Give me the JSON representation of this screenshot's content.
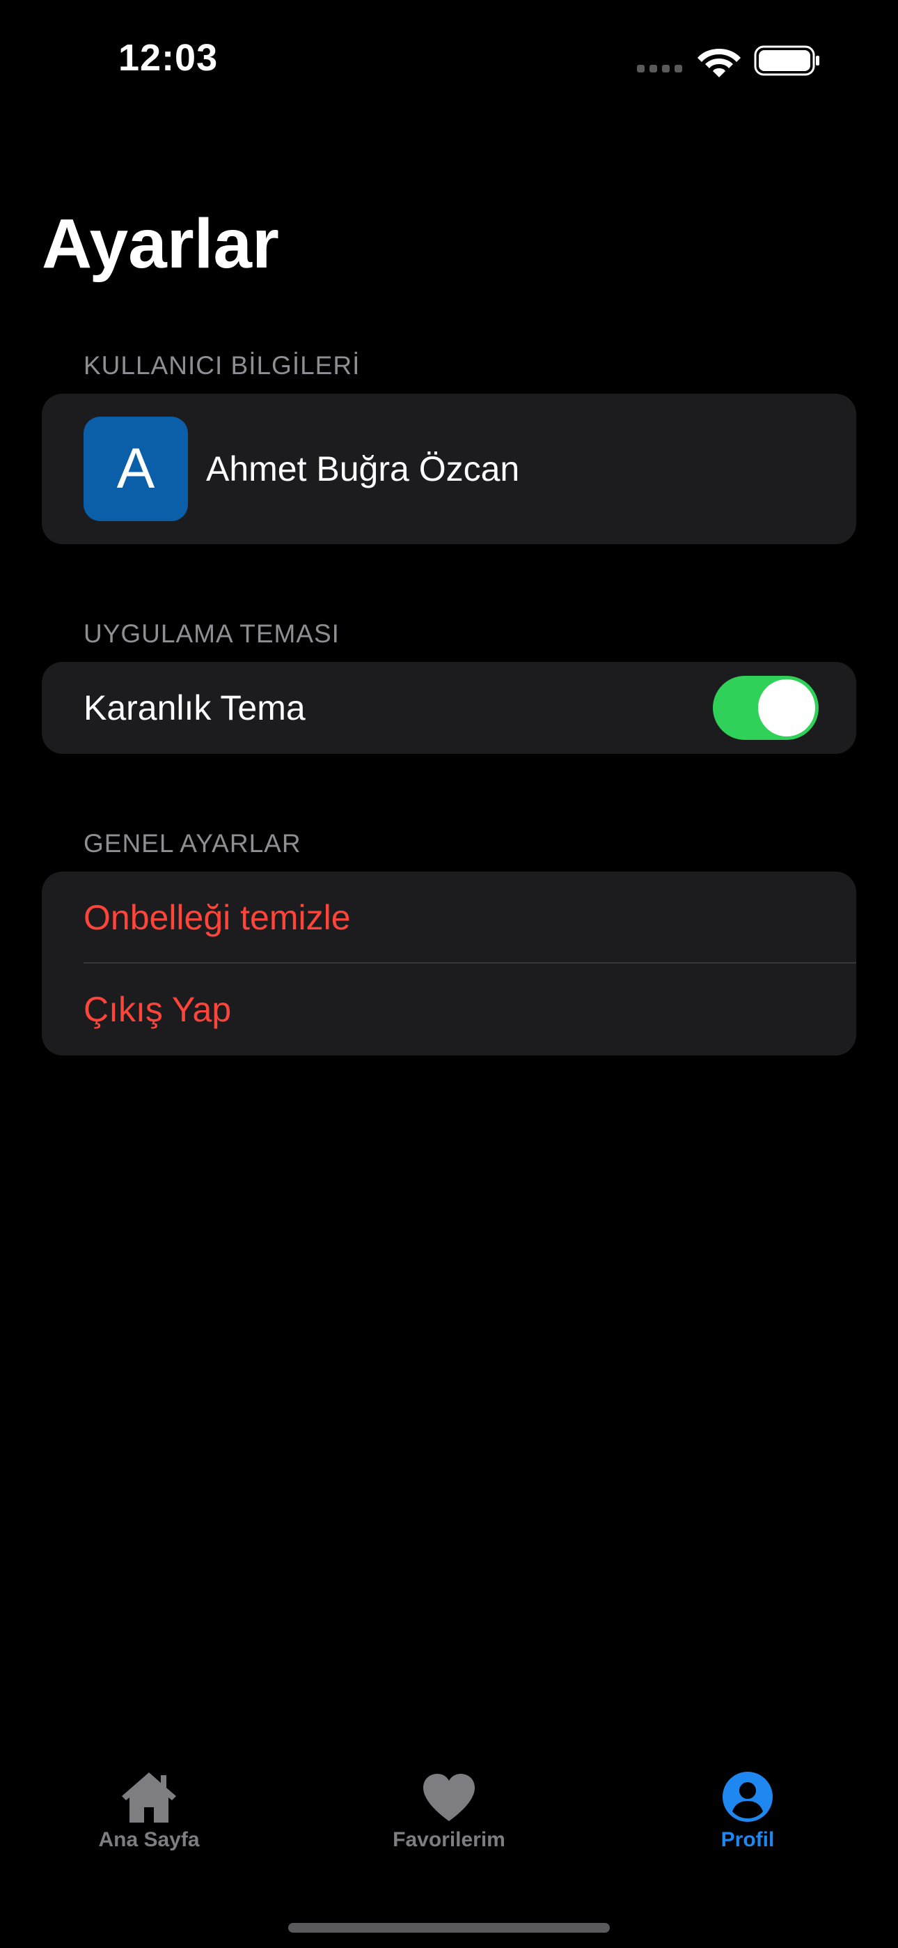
{
  "status_bar": {
    "time": "12:03"
  },
  "title": "Ayarlar",
  "sections": {
    "user_info": {
      "header": "KULLANICI BİLGİLERİ",
      "avatar_letter": "A",
      "avatar_color": "#0b5ea8",
      "user_name": "Ahmet Buğra Özcan"
    },
    "app_theme": {
      "header": "UYGULAMA TEMASI",
      "dark_theme_label": "Karanlık Tema",
      "dark_theme_enabled": true,
      "toggle_color": "#30d158"
    },
    "general": {
      "header": "GENEL AYARLAR",
      "clear_cache_label": "Onbelleği temizle",
      "logout_label": "Çıkış Yap",
      "destructive_color": "#ff453a"
    }
  },
  "tab_bar": {
    "tabs": [
      {
        "label": "Ana Sayfa",
        "icon": "house-icon",
        "active": false
      },
      {
        "label": "Favorilerim",
        "icon": "heart-icon",
        "active": false
      },
      {
        "label": "Profil",
        "icon": "person-circle-icon",
        "active": true
      }
    ],
    "active_color": "#1e87f0",
    "inactive_color": "#7d7d82"
  }
}
